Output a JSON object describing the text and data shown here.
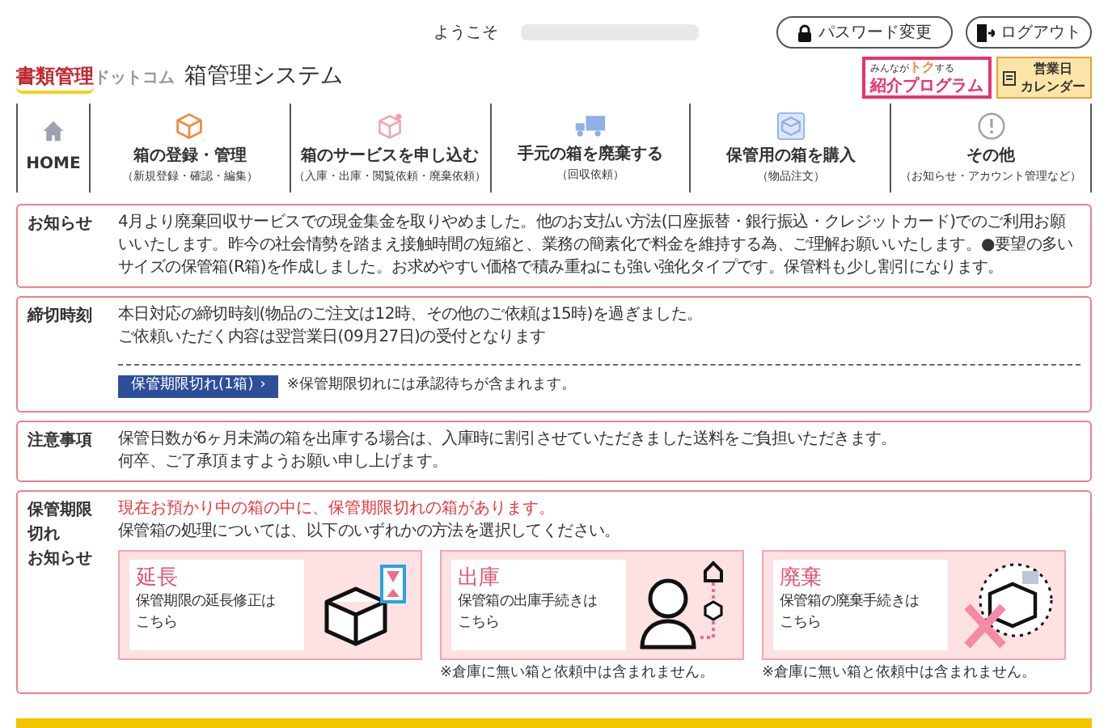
{
  "header": {
    "welcome": "ようこそ",
    "password_button": "パスワード変更",
    "logout_button": "ログアウト",
    "logo_text": "書類管理",
    "logo_suffix": "ドットコム",
    "system_title": "箱管理システム",
    "referral": {
      "small": "みんなが",
      "accent": "トク",
      "small_after": "する",
      "main": "紹介プログラム"
    },
    "calendar": [
      "営業日",
      "カレンダー"
    ]
  },
  "nav": [
    {
      "kind": "home",
      "label": "HOME"
    },
    {
      "kind": "menu",
      "label": "箱の登録・管理",
      "sub": "（新規登録・確認・編集）"
    },
    {
      "kind": "menu",
      "label": "箱のサービスを申し込む",
      "sub": "（入庫・出庫・閲覧依頼・廃棄依頼）"
    },
    {
      "kind": "menu",
      "label": "手元の箱を廃棄する",
      "sub": "（回収依頼）"
    },
    {
      "kind": "menu",
      "label": "保管用の箱を購入",
      "sub": "（物品注文）"
    },
    {
      "kind": "menu",
      "label": "その他",
      "sub": "（お知らせ・アカウント管理など）"
    }
  ],
  "notices": [
    {
      "kind": "text",
      "title": [
        "お知らせ"
      ],
      "lines": [
        "4月より廃棄回収サービスでの現金集金を取りやめました。他のお支払い方法(口座振替・銀行振込・クレジットカード)でのご利用お願いいたします。昨今の社会情勢を踏まえ接触時間の短縮と、業務の簡素化で料金を維持する為、ご理解お願いいたします。●要望の多いサイズの保管箱(R箱)を作成しました。お求めやすい価格で積み重ねにも強い強化タイプです。保管料も少し割引になります。"
      ]
    },
    {
      "kind": "deadline",
      "title": [
        "締切時刻"
      ],
      "lines": [
        "本日対応の締切時刻(物品のご注文は12時、その他のご依頼は15時)を過ぎました。",
        "ご依頼いただく内容は翌営業日(09月27日)の受付となります"
      ],
      "button": "保管期限切れ(1箱)",
      "button_arrow": "›",
      "button_note": "※保管期限切れには承認待ちが含まれます。"
    },
    {
      "kind": "text",
      "title": [
        "注意事項"
      ],
      "lines": [
        "保管日数が6ヶ月未満の箱を出庫する場合は、入庫時に割引させていただきました送料をご負担いただきます。",
        "何卒、ご了承頂ますようお願い申し上げます。"
      ]
    },
    {
      "kind": "expiry",
      "title": [
        "保管期限",
        "切れ",
        "お知らせ"
      ],
      "alert": "現在お預かり中の箱の中に、保管期限切れの箱があります。",
      "lines": [
        "保管箱の処理については、以下のいずれかの方法を選択してください。"
      ],
      "cards": [
        {
          "title": "延長",
          "desc": [
            "保管期限の延長修正は",
            "こちら"
          ]
        },
        {
          "title": "出庫",
          "desc": [
            "保管箱の出庫手続きは",
            "こちら"
          ],
          "note": "※倉庫に無い箱と依頼中は含まれません。"
        },
        {
          "title": "廃棄",
          "desc": [
            "保管箱の廃棄手続きは",
            "こちら"
          ],
          "note": "※倉庫に無い箱と依頼中は含まれません。"
        }
      ]
    }
  ]
}
